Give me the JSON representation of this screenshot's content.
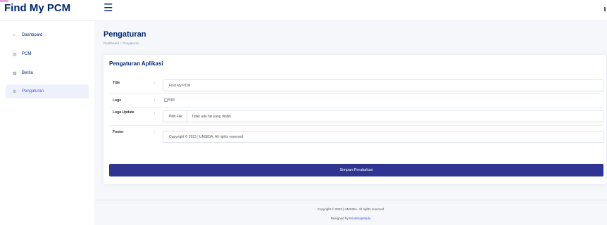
{
  "brand": "Find My PCM",
  "menu_icon": "hamburger-icon",
  "sidebar": {
    "items": [
      {
        "icon": "○",
        "icon_name": "dashboard-icon",
        "label": "Dashboard"
      },
      {
        "icon": "▤",
        "icon_name": "pcm-list-icon",
        "label": "PCM"
      },
      {
        "icon": "▦",
        "icon_name": "news-icon",
        "label": "Berita"
      },
      {
        "icon": "⚙",
        "icon_name": "gear-icon",
        "label": "Pengaturan"
      }
    ],
    "active_index": 3
  },
  "page": {
    "title": "Pengaturan",
    "breadcrumb": {
      "home": "Dashboard",
      "separator": "/",
      "current": "Pengaturan"
    }
  },
  "form": {
    "card_title": "Pengaturan Aplikasi",
    "colon": ":",
    "title_label": "Title",
    "title_value": "Find My PCM",
    "logo_label": "Logo",
    "logo_alt": "logo",
    "logo_update_label": "Logo Update",
    "file_button": "Pilih File",
    "file_status": "Tidak ada file yang dipilih",
    "footer_label": "Footer",
    "footer_value": "Copyright © 2023 | UMSIDA. All rights reserved",
    "save_button": "Simpan Perubahan"
  },
  "footer": {
    "copyright": "Copyright © 2023 | UMSIDA. All rights reserved",
    "credit_prefix": "Designed by",
    "credit_link": "BootstrapMade"
  },
  "colors": {
    "accent": "#2f3590",
    "brand": "#012970",
    "background": "#f5f7fb"
  }
}
